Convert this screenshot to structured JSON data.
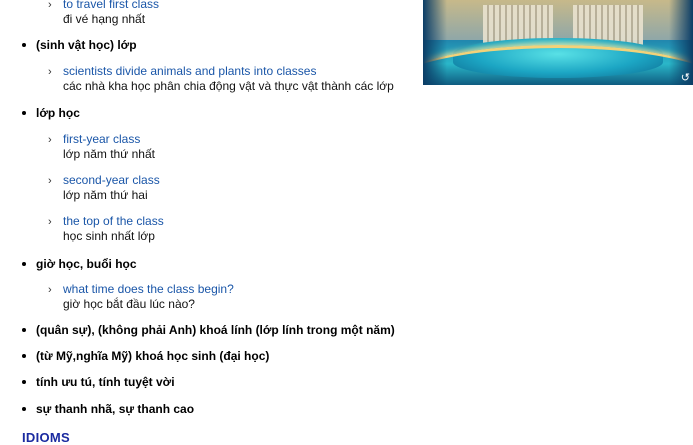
{
  "entries": [
    {
      "type": "example",
      "en": "to travel first class",
      "vi": "đi vé hạng nhất"
    },
    {
      "type": "sense",
      "label": "(sinh vật học) lớp"
    },
    {
      "type": "example",
      "en": "scientists divide animals and plants into classes",
      "vi": "các nhà kha học phân chia động vật và thực vật thành các lớp"
    },
    {
      "type": "sense",
      "label": "lớp học"
    },
    {
      "type": "example",
      "en": "first-year class",
      "vi": "lớp năm thứ nhất"
    },
    {
      "type": "example",
      "en": "second-year class",
      "vi": "lớp năm thứ hai"
    },
    {
      "type": "example",
      "en": "the top of the class",
      "vi": "học sinh nhất lớp"
    },
    {
      "type": "sense",
      "label": "giờ học, buổi học"
    },
    {
      "type": "example",
      "en": "what time does the class begin?",
      "vi": "giờ học bắt đầu lúc nào?"
    },
    {
      "type": "sense",
      "label": "(quân sự), (không phải Anh) khoá lính (lớp lính trong một năm)"
    },
    {
      "type": "sense",
      "label": "(từ Mỹ,nghĩa Mỹ) khoá học sinh (đại học)"
    },
    {
      "type": "sense",
      "label": "tính ưu tú, tính tuyệt vời"
    },
    {
      "type": "sense",
      "label": "sự thanh nhã, sự thanh cao"
    }
  ],
  "idioms_heading": "IDIOMS",
  "ad": {
    "reload_icon": "reload-icon",
    "reload_glyph": "↺"
  },
  "colors": {
    "link": "#1a56a8",
    "idioms": "#1a2aa0"
  }
}
